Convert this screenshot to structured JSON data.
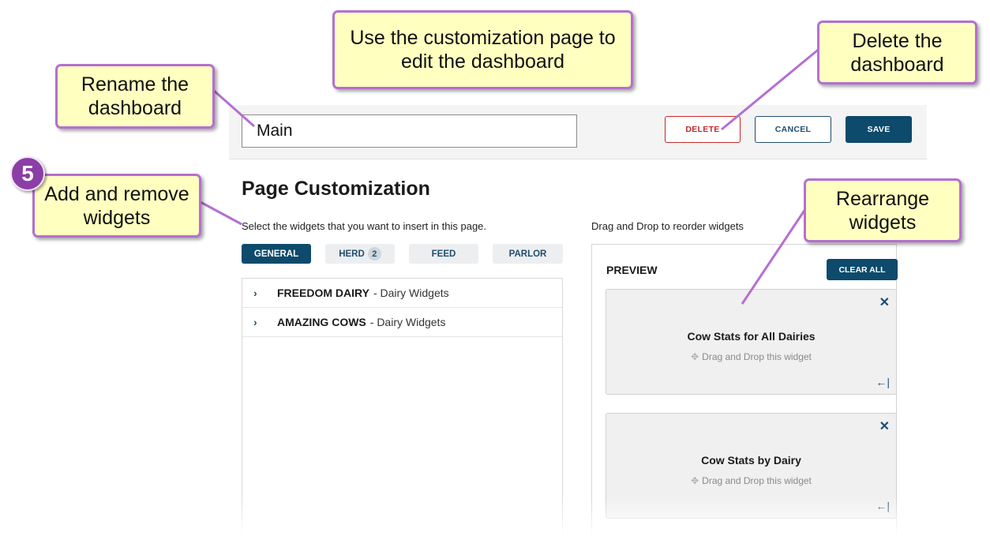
{
  "header": {
    "dashboard_name": "Main",
    "delete_label": "DELETE",
    "cancel_label": "CANCEL",
    "save_label": "SAVE"
  },
  "page": {
    "title": "Page Customization",
    "left_hint": "Select the widgets that you want to insert in this page.",
    "right_hint": "Drag and Drop to reorder widgets"
  },
  "tabs": [
    {
      "label": "GENERAL",
      "active": true
    },
    {
      "label": "HERD",
      "badge": "2"
    },
    {
      "label": "FEED"
    },
    {
      "label": "PARLOR"
    }
  ],
  "widget_groups": [
    {
      "name": "FREEDOM DAIRY",
      "sub": "- Dairy Widgets"
    },
    {
      "name": "AMAZING COWS",
      "sub": "- Dairy Widgets"
    }
  ],
  "preview": {
    "label": "PREVIEW",
    "clear_label": "CLEAR ALL",
    "cards": [
      {
        "title": "Cow Stats for All Dairies",
        "drag_hint": "Drag and Drop this widget"
      },
      {
        "title": "Cow Stats by Dairy",
        "drag_hint": "Drag and Drop this widget"
      }
    ]
  },
  "callouts": {
    "rename": "Rename the dashboard",
    "customize": "Use the customization page to edit the dashboard",
    "delete": "Delete the dashboard",
    "add_remove": "Add and remove widgets",
    "rearrange": "Rearrange widgets"
  },
  "step_number": "5",
  "icons": {
    "chevron": "chevron-right-icon",
    "close": "close-icon",
    "drag": "drag-move-icon",
    "collapse": "collapse-left-icon"
  },
  "colors": {
    "primary": "#0d4a6b",
    "danger": "#c62828",
    "callout_fill": "#ffffc0",
    "callout_border": "#b46fd1",
    "step_badge": "#8b3ea6"
  }
}
